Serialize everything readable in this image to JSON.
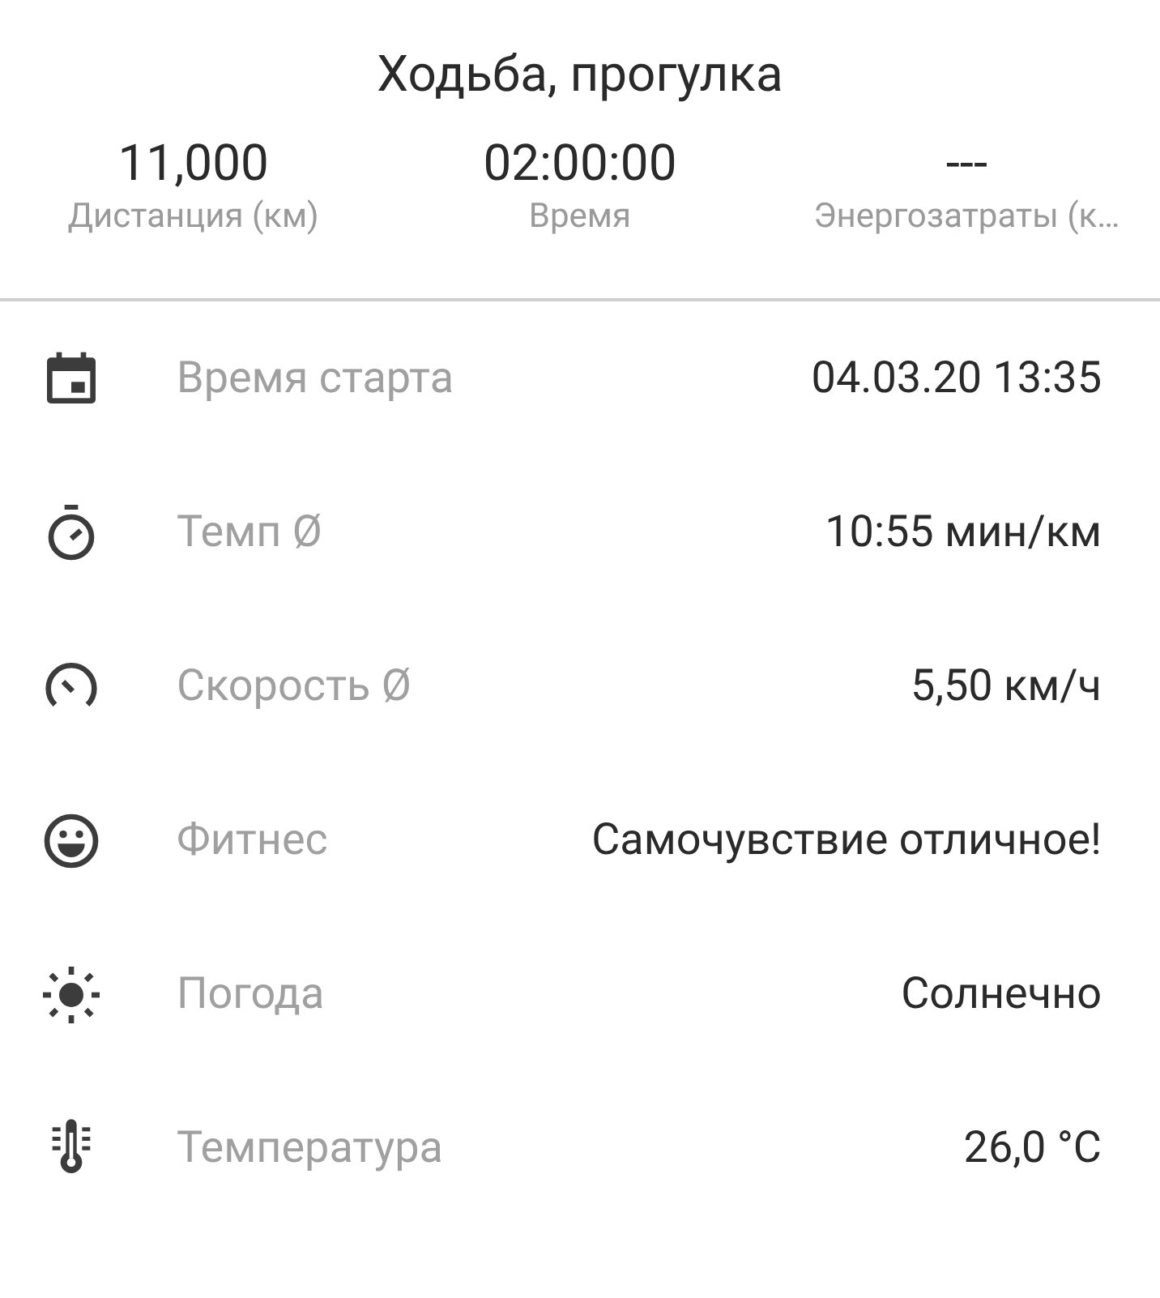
{
  "title": "Ходьба, прогулка",
  "stats": [
    {
      "value": "11,000",
      "label": "Дистанция (км)"
    },
    {
      "value": "02:00:00",
      "label": "Время"
    },
    {
      "value": "---",
      "label": "Энергозатраты (к…"
    }
  ],
  "rows": [
    {
      "kind": "calendar",
      "label": "Время старта",
      "value": "04.03.20 13:35"
    },
    {
      "kind": "stopwatch",
      "label": "Темп Ø",
      "value": "10:55 мин/км"
    },
    {
      "kind": "gauge",
      "label": "Скорость Ø",
      "value": "5,50 км/ч"
    },
    {
      "kind": "smiley",
      "label": "Фитнес",
      "value": "Самочувствие отличное!"
    },
    {
      "kind": "sun",
      "label": "Погода",
      "value": "Солнечно"
    },
    {
      "kind": "thermometer",
      "label": "Температура",
      "value": "26,0 °C"
    }
  ]
}
